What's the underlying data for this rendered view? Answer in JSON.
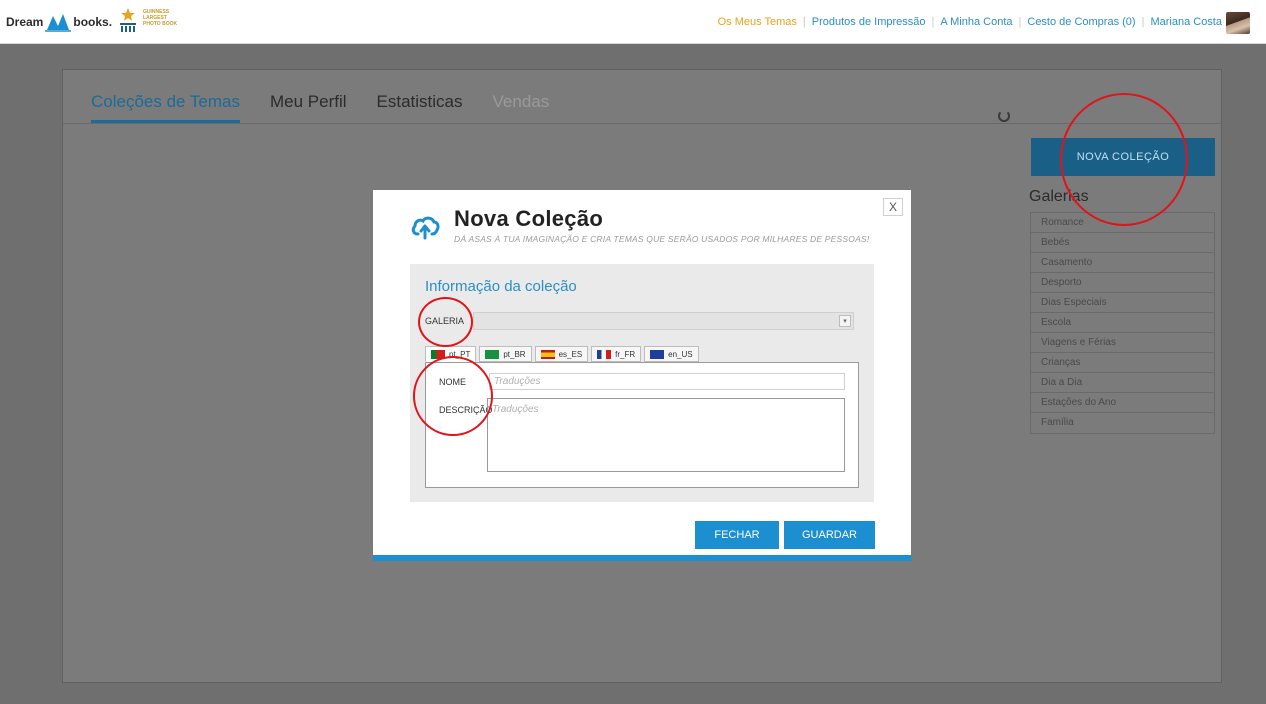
{
  "brand": {
    "name_left": "Dream",
    "name_right": "books.",
    "badge_lines": [
      "GUINNESS",
      "LARGEST",
      "PHOTO BOOK"
    ]
  },
  "topnav": {
    "items": [
      "Os Meus Temas",
      "Produtos de Impressão",
      "A Minha Conta",
      "Cesto de Compras (0)",
      "Mariana Costa"
    ]
  },
  "tabs": [
    "Coleções de Temas",
    "Meu Perfil",
    "Estatisticas",
    "Vendas"
  ],
  "sidebar": {
    "new_collection": "NOVA COLEÇÃO",
    "galleries_title": "Galerias",
    "galleries": [
      "Romance",
      "Bebés",
      "Casamento",
      "Desporto",
      "Dias Especiais",
      "Escola",
      "Viagens e Férias",
      "Crianças",
      "Dia a Dia",
      "Estações do Ano",
      "Família"
    ]
  },
  "modal": {
    "close": "X",
    "title": "Nova Coleção",
    "subtitle": "DÁ ASAS À TUA IMAGINAÇÃO E CRIA TEMAS QUE SERÃO USADOS POR MILHARES DE PESSOAS!",
    "section_title": "Informação da coleção",
    "galeria_label": "GALERIA",
    "galeria_value": "",
    "languages": [
      "pt_PT",
      "pt_BR",
      "es_ES",
      "fr_FR",
      "en_US"
    ],
    "nome_label": "NOME",
    "nome_placeholder": "Traduções",
    "desc_label": "DESCRIÇÃO",
    "desc_placeholder": "Traduções",
    "btn_close": "FECHAR",
    "btn_save": "GUARDAR"
  },
  "colors": {
    "accent": "#1c8fd0",
    "link": "#2a8fc4",
    "active_link": "#e8a21c",
    "annotation": "#e0141b"
  }
}
